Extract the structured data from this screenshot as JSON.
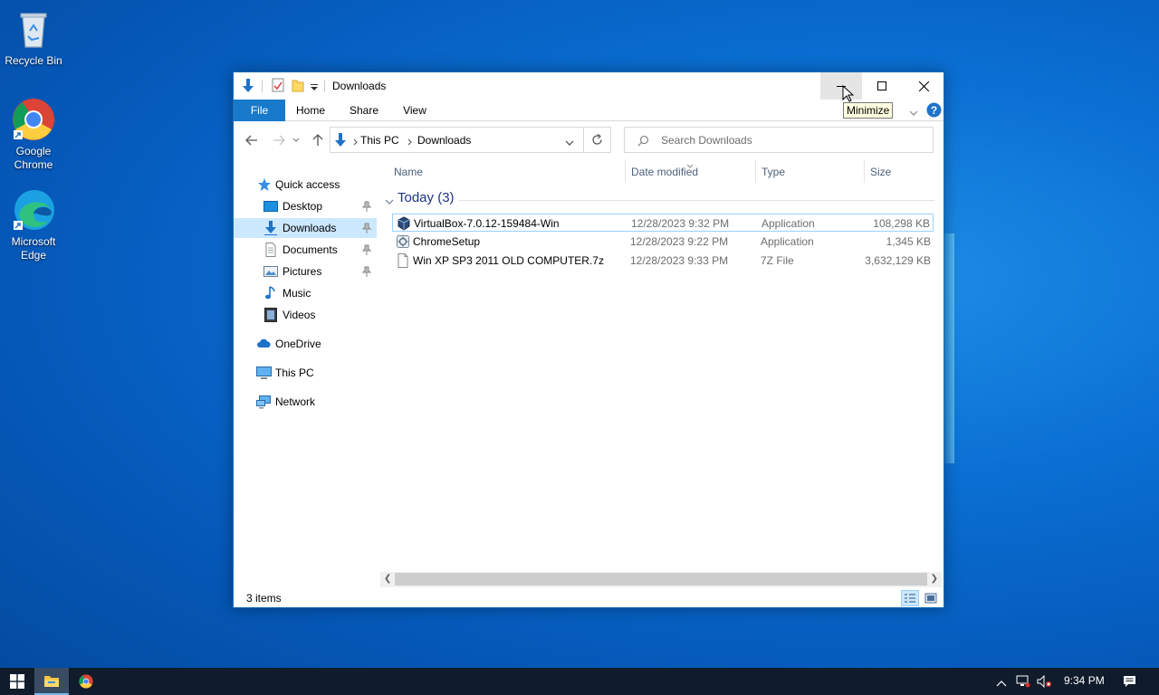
{
  "desktop": {
    "icons": [
      {
        "label": "Recycle Bin"
      },
      {
        "label": "Google Chrome"
      },
      {
        "label": "Microsoft Edge"
      }
    ]
  },
  "window": {
    "title": "Downloads",
    "tooltip": "Minimize",
    "ribbon_tabs": [
      "File",
      "Home",
      "Share",
      "View"
    ],
    "address": {
      "crumbs": [
        "This PC",
        "Downloads"
      ]
    },
    "search": {
      "placeholder": "Search Downloads"
    },
    "nav": {
      "items": [
        {
          "label": "Quick access",
          "icon": "star-icon"
        },
        {
          "label": "Desktop",
          "icon": "desktop-folder-icon",
          "pinned": true
        },
        {
          "label": "Downloads",
          "icon": "download-arrow-icon",
          "pinned": true,
          "selected": true
        },
        {
          "label": "Documents",
          "icon": "documents-icon",
          "pinned": true
        },
        {
          "label": "Pictures",
          "icon": "pictures-icon",
          "pinned": true
        },
        {
          "label": "Music",
          "icon": "music-icon"
        },
        {
          "label": "Videos",
          "icon": "videos-icon"
        },
        {
          "label": "OneDrive",
          "icon": "cloud-icon"
        },
        {
          "label": "This PC",
          "icon": "computer-icon"
        },
        {
          "label": "Network",
          "icon": "network-icon"
        }
      ]
    },
    "columns": [
      "Name",
      "Date modified",
      "Type",
      "Size"
    ],
    "group": {
      "label": "Today (3)"
    },
    "files": [
      {
        "name": "VirtualBox-7.0.12-159484-Win",
        "date": "12/28/2023 9:32 PM",
        "type": "Application",
        "size": "108,298 KB",
        "icon": "virtualbox-icon"
      },
      {
        "name": "ChromeSetup",
        "date": "12/28/2023 9:22 PM",
        "type": "Application",
        "size": "1,345 KB",
        "icon": "setup-icon"
      },
      {
        "name": "Win XP SP3 2011 OLD COMPUTER.7z",
        "date": "12/28/2023 9:33 PM",
        "type": "7Z File",
        "size": "3,632,129 KB",
        "icon": "file-icon"
      }
    ],
    "status": {
      "items_count": "3 items"
    }
  },
  "taskbar": {
    "time": "9:34 PM"
  },
  "colors": {
    "accent": "#1979ca",
    "selection": "#cce8ff",
    "desktop_bg": "#0a6fd3",
    "taskbar_bg": "#101b2b"
  }
}
